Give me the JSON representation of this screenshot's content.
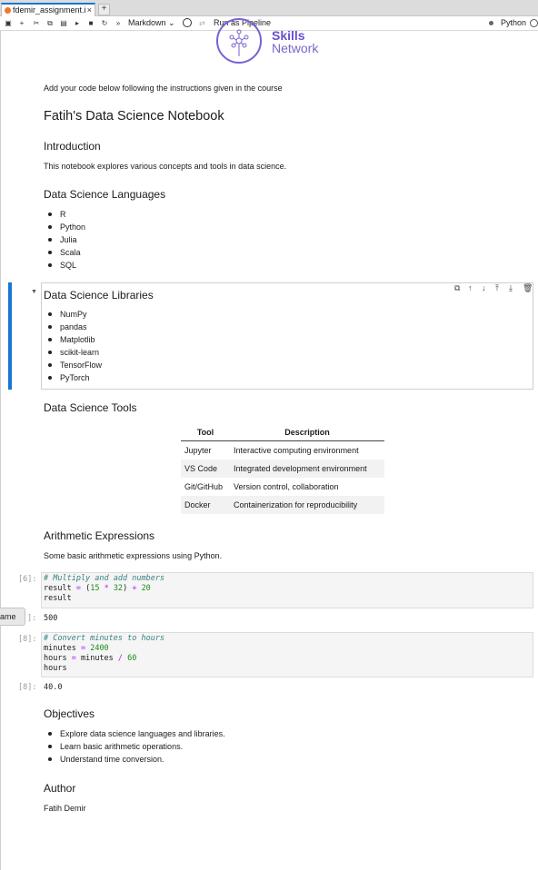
{
  "tab": {
    "title": "fdemir_assignment.i",
    "close": "×",
    "add": "+"
  },
  "toolbar": {
    "icons": [
      "save-icon",
      "add-cell-icon",
      "cut-icon",
      "copy-icon",
      "paste-icon",
      "run-icon",
      "stop-icon",
      "restart-icon",
      "run-all-icon"
    ],
    "cell_type": "Markdown ⌄",
    "pipeline": "Run as Pipeline",
    "kernel": "Python"
  },
  "logo": {
    "line1": "Skills",
    "line2": "Network"
  },
  "intro_line": "Add your code below following the instructions given in the course",
  "title": "Fatih's Data Science Notebook",
  "introduction": {
    "heading": "Introduction",
    "text": "This notebook explores various concepts and tools in data science."
  },
  "languages": {
    "heading": "Data Science Languages",
    "items": [
      "R",
      "Python",
      "Julia",
      "Scala",
      "SQL"
    ]
  },
  "libraries": {
    "heading": "Data Science Libraries",
    "items": [
      "NumPy",
      "pandas",
      "Matplotlib",
      "scikit-learn",
      "TensorFlow",
      "PyTorch"
    ]
  },
  "tools": {
    "heading": "Data Science Tools",
    "columns": [
      "Tool",
      "Description"
    ],
    "rows": [
      [
        "Jupyter",
        "Interactive computing environment"
      ],
      [
        "VS Code",
        "Integrated development environment"
      ],
      [
        "Git/GitHub",
        "Version control, collaboration"
      ],
      [
        "Docker",
        "Containerization for reproducibility"
      ]
    ]
  },
  "arithmetic": {
    "heading": "Arithmetic Expressions",
    "text": "Some basic arithmetic expressions using Python."
  },
  "cell1": {
    "prompt_in": "[6]:",
    "comment": "# Multiply and add numbers",
    "line2a": "result ",
    "line2b": "=",
    "line2c": " (",
    "line2d": "15",
    "line2e": " * ",
    "line2f": "32",
    "line2g": ") ",
    "line2h": "+",
    "line2i": " ",
    "line2j": "20",
    "line3": "result",
    "prompt_out": "]:",
    "output": "500"
  },
  "cell2": {
    "prompt_in": "[8]:",
    "comment": "# Convert minutes to hours",
    "l2a": "minutes ",
    "l2b": "=",
    "l2c": " ",
    "l2d": "2400",
    "l3a": "hours ",
    "l3b": "=",
    "l3c": " minutes ",
    "l3d": "/",
    "l3e": " ",
    "l3f": "60",
    "l4": "hours",
    "prompt_out": "[8]:",
    "output": "40.0"
  },
  "tooltip": "ame",
  "objectives": {
    "heading": "Objectives",
    "items": [
      "Explore data science languages and libraries.",
      "Learn basic arithmetic operations.",
      "Understand time conversion."
    ]
  },
  "author": {
    "heading": "Author",
    "name": "Fatih Demir"
  }
}
